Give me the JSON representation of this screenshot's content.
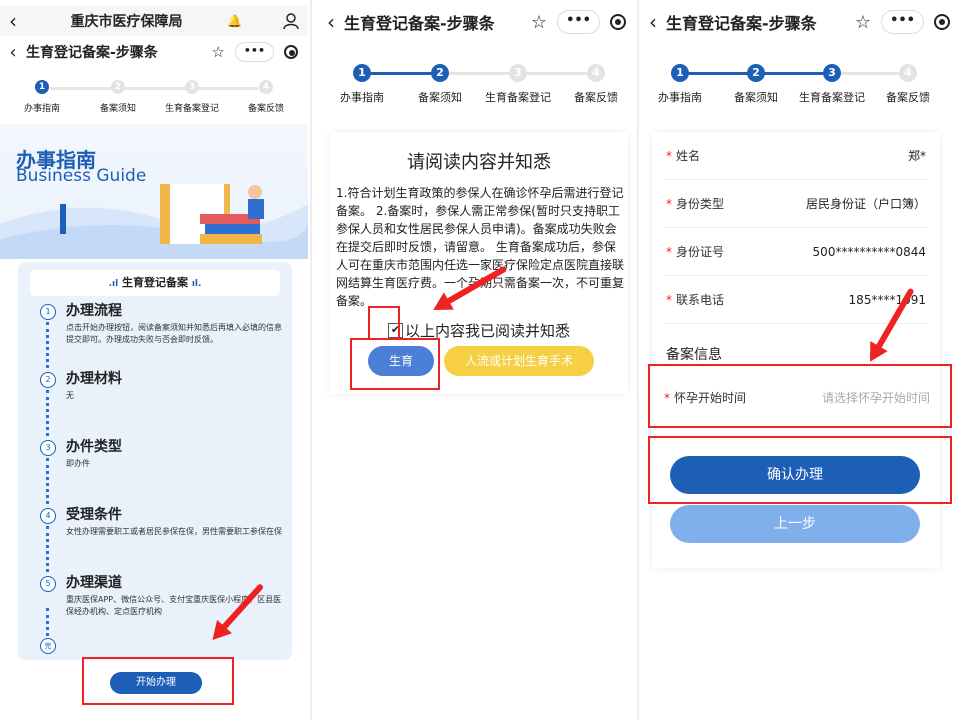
{
  "steps": [
    "办事指南",
    "备案须知",
    "生育备案登记",
    "备案反馈"
  ],
  "panel1": {
    "top_bar_title": "重庆市医疗保障局",
    "nav_title": "生育登记备案-步骤条",
    "hero_title": "办事指南",
    "hero_subtitle": "Business Guide",
    "card_header": "生育登记备案",
    "sections": [
      {
        "num": "1",
        "title": "办理流程",
        "body": "点击开始办理按钮，阅读备案须知并知悉后再填入必填的信息提交即可。办理成功失败与否会即时反馈。"
      },
      {
        "num": "2",
        "title": "办理材料",
        "body": "无"
      },
      {
        "num": "3",
        "title": "办件类型",
        "body": "即办件"
      },
      {
        "num": "4",
        "title": "受理条件",
        "body": "女性办理需要职工或者居民参保在保，男性需要职工参保在保"
      },
      {
        "num": "5",
        "title": "办理渠道",
        "body": "重庆医保APP、微信公众号、支付宝重庆医保小程序、区县医保经办机构、定点医疗机构"
      }
    ],
    "end_label": "完",
    "start_button": "开始办理"
  },
  "panel2": {
    "nav_title": "生育登记备案-步骤条",
    "card_title": "请阅读内容并知悉",
    "notice": "1.符合计划生育政策的参保人在确诊怀孕后需进行登记备案。 2.备案时，参保人需正常参保(暂时只支持职工参保人员和女性居民参保人员申请)。备案成功失败会在提交后即时反馈，请留意。 生育备案成功后，参保人可在重庆市范围内任选一家医疗保险定点医院直接联网结算生育医疗费。一个孕期只需备案一次，不可重复备案。",
    "agree_text": "以上内容我已阅读并知悉",
    "check_mark": "✔",
    "btn_birth": "生育",
    "btn_abortion": "人流或计划生育手术"
  },
  "panel3": {
    "nav_title": "生育登记备案-步骤条",
    "rows": [
      {
        "label": "姓名",
        "value": "郑*"
      },
      {
        "label": "身份类型",
        "value": "居民身份证（户口簿）"
      },
      {
        "label": "身份证号",
        "value": "500**********0844"
      },
      {
        "label": "联系电话",
        "value": "185****1091"
      }
    ],
    "section_title": "备案信息",
    "pregnancy_label": "怀孕开始时间",
    "pregnancy_placeholder": "请选择怀孕开始时间",
    "required_mark": "*",
    "confirm_button": "确认办理",
    "prev_button": "上一步"
  },
  "icons": {
    "back": "back-arrow-icon",
    "star": "star-icon",
    "more": "more-icon",
    "target": "target-icon",
    "user": "user-icon",
    "bell": "bell-icon"
  },
  "colors": {
    "primary": "#1d5fb6",
    "light_blue": "#7fb0ec",
    "yellow": "#f6cf45",
    "annotation_red": "#e22222",
    "required_red": "#e22222"
  }
}
